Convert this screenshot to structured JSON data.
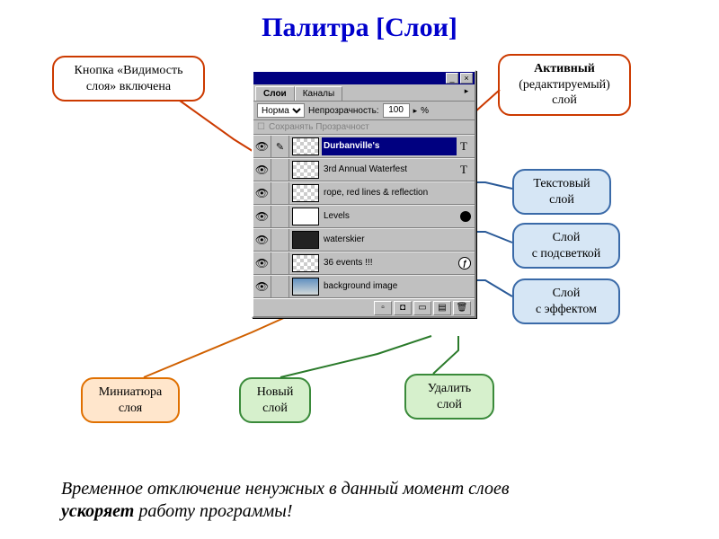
{
  "title": "Палитра [Слои]",
  "callouts": {
    "visibility": {
      "l1": "Кнопка «Видимость",
      "l2": "слоя» включена"
    },
    "active": {
      "l1": "Активный",
      "l2": "(редактируемый)",
      "l3": "слой"
    },
    "text": {
      "l1": "Текстовый",
      "l2": "слой"
    },
    "highlight": {
      "l1": "Слой",
      "l2": "с подсветкой"
    },
    "effect": {
      "l1": "Слой",
      "l2": "с эффектом"
    },
    "thumb": {
      "l1": "Миниатюра",
      "l2": "слоя"
    },
    "new": {
      "l1": "Новый",
      "l2": "слой"
    },
    "delete": {
      "l1": "Удалить",
      "l2": "слой"
    }
  },
  "panel": {
    "tabs": {
      "layers": "Слои",
      "channels": "Каналы"
    },
    "mode": "Норма",
    "opacity_label": "Непрозрачность:",
    "opacity_value": "100",
    "opacity_pct": "%",
    "preserve_label": "Сохранять Прозрачност",
    "layers": [
      {
        "name": "Durbanville's",
        "active": true,
        "textBadge": "T",
        "thumb": "check"
      },
      {
        "name": "3rd Annual Waterfest",
        "textBadge": "T",
        "thumb": "check"
      },
      {
        "name": "rope, red lines & reflection",
        "thumb": "check"
      },
      {
        "name": "Levels",
        "dot": true,
        "thumb": "white"
      },
      {
        "name": "waterskier",
        "thumb": "dark"
      },
      {
        "name": "36 events !!!",
        "fx": true,
        "thumb": "check"
      },
      {
        "name": "background image",
        "thumb": "img"
      }
    ]
  },
  "footnote": {
    "l1": "Временное отключение ненужных в данный момент слоев",
    "l2a": "ускоряет",
    "l2b": " работу программы!"
  }
}
